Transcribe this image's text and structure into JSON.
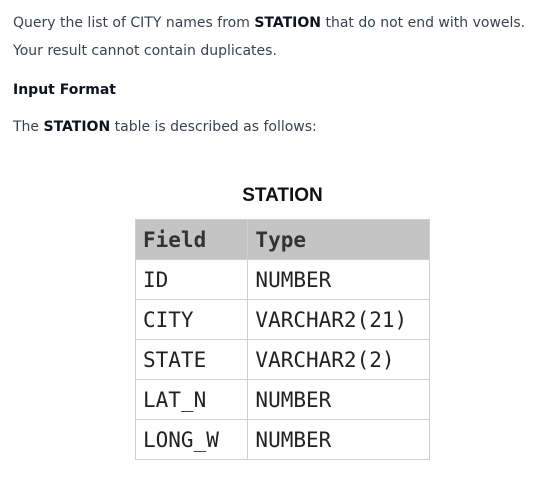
{
  "problem": {
    "statement_prefix": "Query the list of CITY names from ",
    "statement_table": "STATION",
    "statement_suffix": " that do not end with vowels. Your result cannot contain duplicates.",
    "input_format_heading": "Input Format",
    "described_prefix": "The ",
    "described_table": "STATION",
    "described_suffix": " table is described as follows:"
  },
  "table": {
    "title": "STATION",
    "headers": [
      "Field",
      "Type"
    ],
    "rows": [
      [
        "ID",
        "NUMBER"
      ],
      [
        "CITY",
        "VARCHAR2(21)"
      ],
      [
        "STATE",
        "VARCHAR2(2)"
      ],
      [
        "LAT_N",
        "NUMBER"
      ],
      [
        "LONG_W",
        "NUMBER"
      ]
    ]
  },
  "colors": {
    "text": "#39424e",
    "bold_text": "#0e141e",
    "table_header_bg": "#c4c4c4",
    "table_border": "#cfcfcf"
  }
}
